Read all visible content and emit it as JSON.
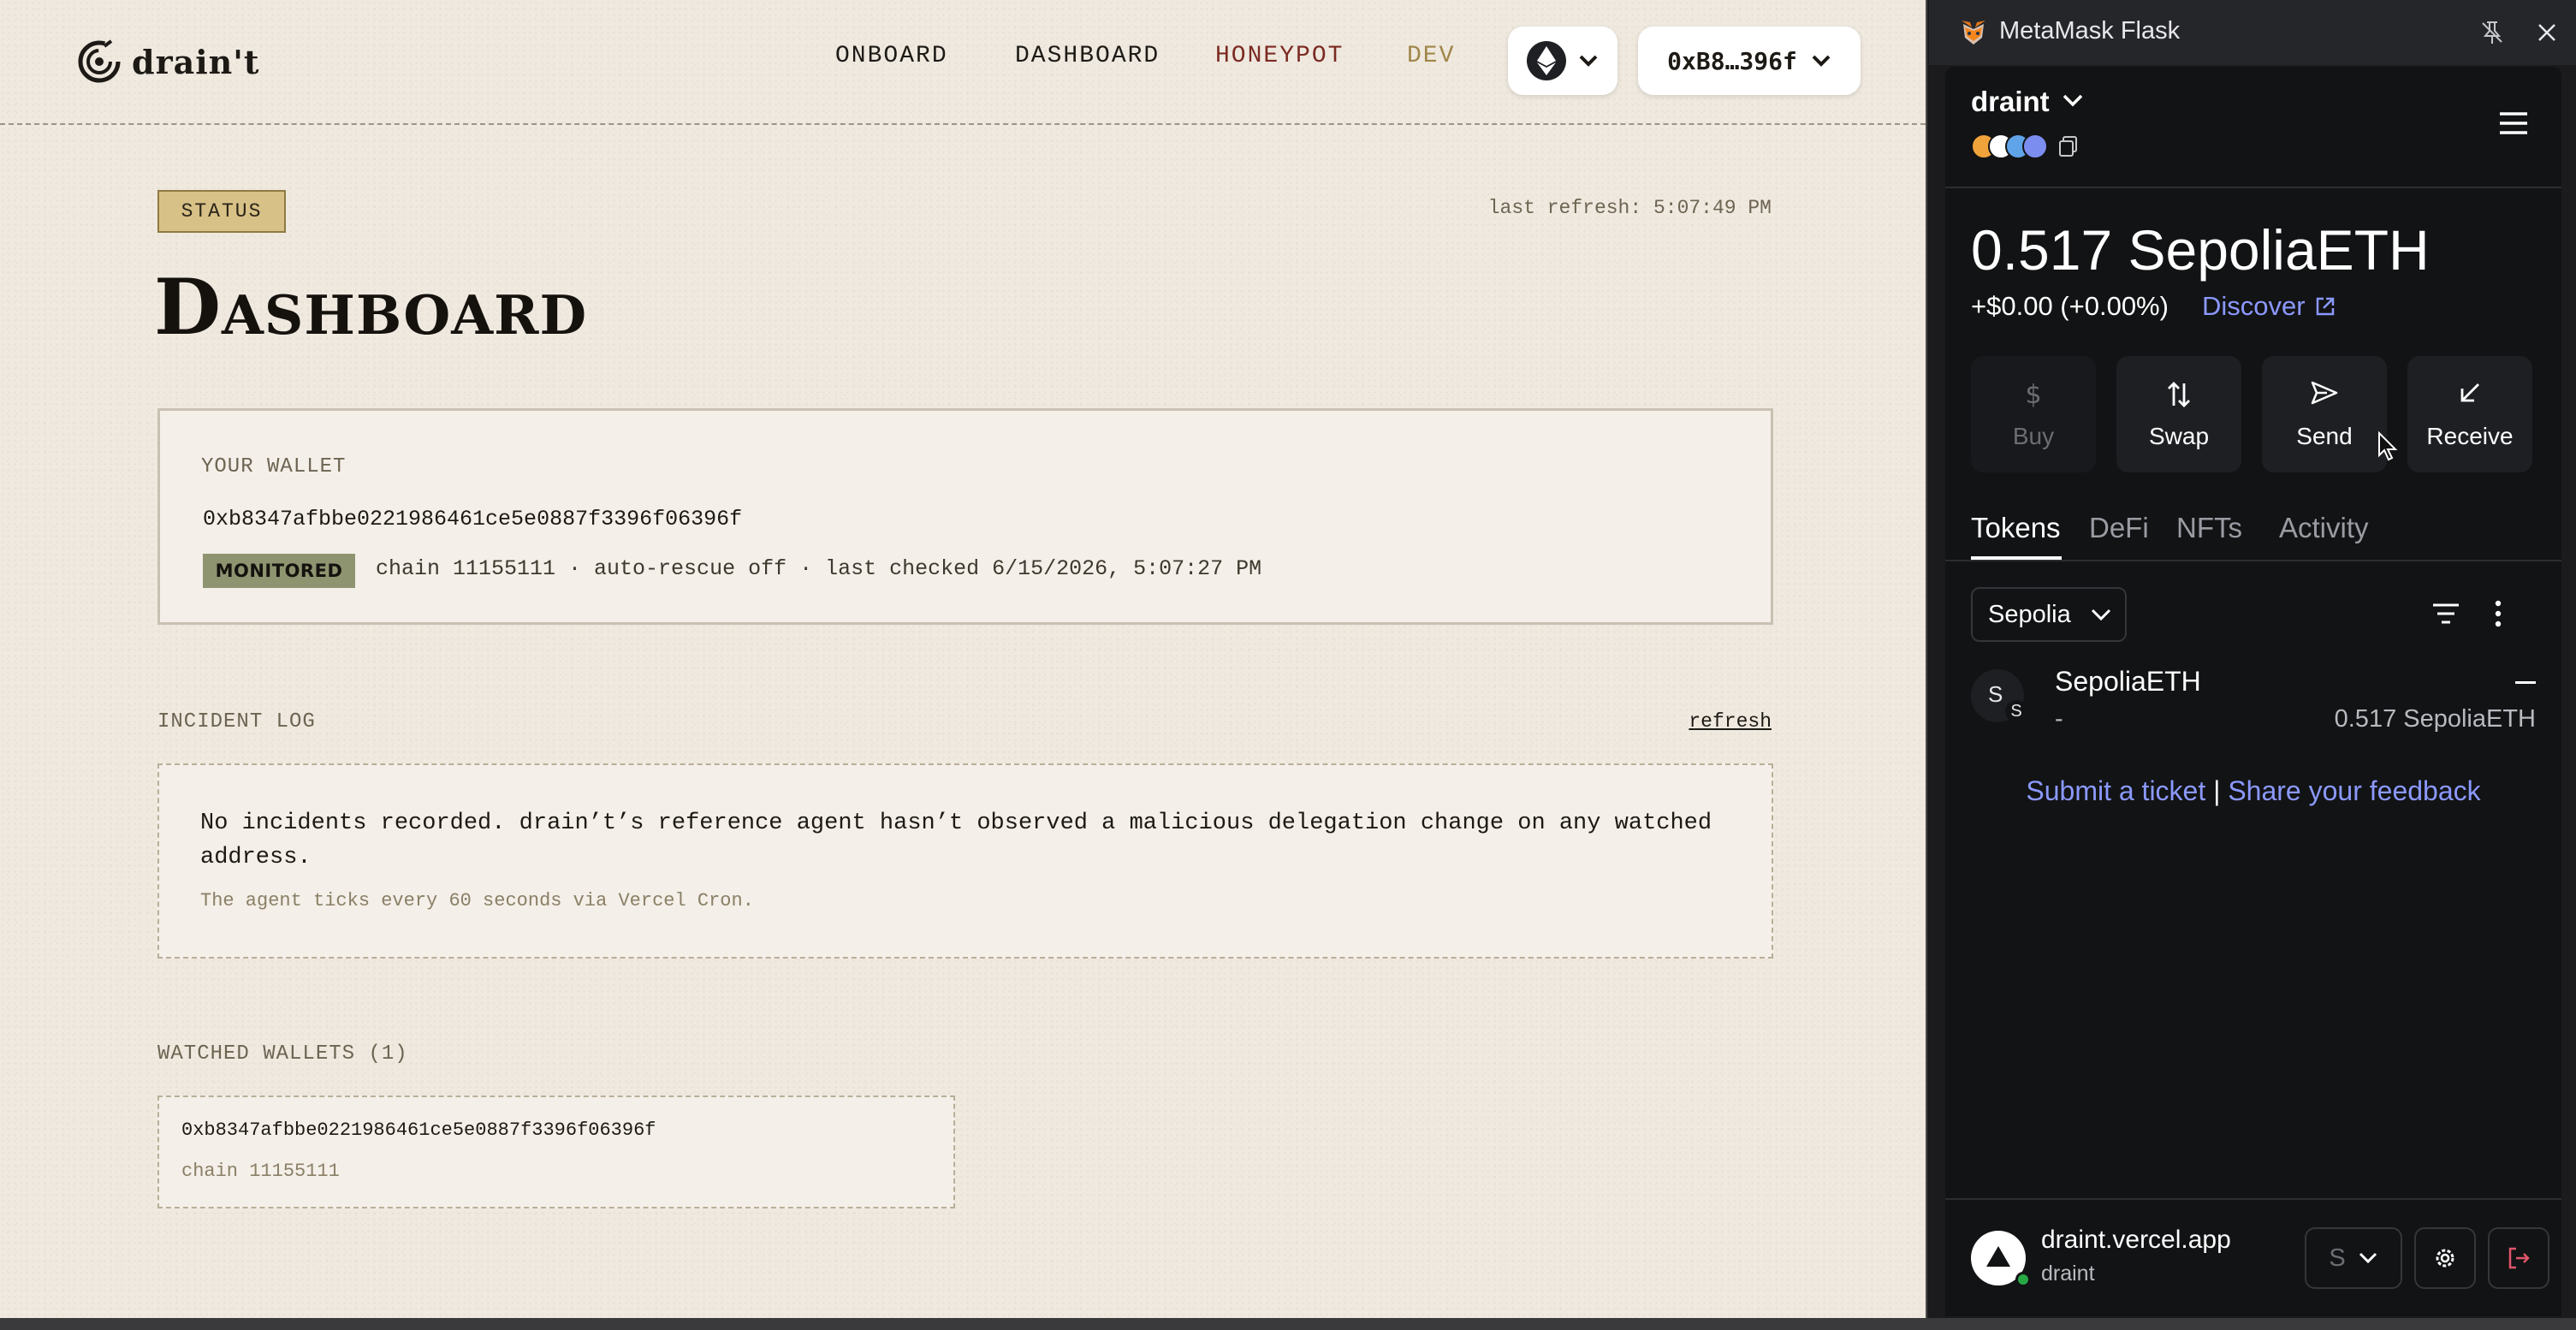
{
  "app": {
    "logo_text": "drain't",
    "nav": {
      "links": [
        {
          "label": "ONBOARD"
        },
        {
          "label": "DASHBOARD"
        },
        {
          "label": "HONEYPOT"
        },
        {
          "label": "DEV"
        }
      ],
      "chain_icon": "ethereum-icon",
      "account_label": "0xB8…396f"
    },
    "status_tag": "STATUS",
    "last_refresh": "last refresh: 5:07:49 PM",
    "title": "Dashboard",
    "wallet_card": {
      "label": "YOUR WALLET",
      "address": "0xb8347afbbe0221986461ce5e0887f3396f06396f",
      "badge": "MONITORED",
      "meta": "chain 11155111 · auto-rescue off · last checked 6/15/2026, 5:07:27 PM"
    },
    "incident_log": {
      "label": "INCIDENT LOG",
      "refresh": "refresh",
      "message": "No incidents recorded. drain’t’s reference agent hasn’t observed a malicious delegation change on any watched address.",
      "sub": "The agent ticks every 60 seconds via Vercel Cron."
    },
    "watched": {
      "label": "WATCHED WALLETS (1)",
      "items": [
        {
          "address": "0xb8347afbbe0221986461ce5e0887f3396f06396f",
          "chain": "chain 11155111"
        }
      ]
    },
    "colors": {
      "background": "#efe9df",
      "accent": "#d8c187",
      "honeypot": "#7b2a22",
      "dev": "#a08548",
      "badge": "#8e9470"
    }
  },
  "metamask": {
    "window_title": "MetaMask Flask",
    "account_name": "draint",
    "balance": "0.517 SepoliaETH",
    "change": "+$0.00 (+0.00%)",
    "discover": "Discover",
    "actions": [
      {
        "label": "Buy",
        "icon": "dollar-icon",
        "disabled": true
      },
      {
        "label": "Swap",
        "icon": "swap-icon",
        "disabled": false
      },
      {
        "label": "Send",
        "icon": "send-icon",
        "disabled": false
      },
      {
        "label": "Receive",
        "icon": "receive-icon",
        "disabled": false
      }
    ],
    "tabs": [
      {
        "label": "Tokens",
        "active": true
      },
      {
        "label": "DeFi",
        "active": false
      },
      {
        "label": "NFTs",
        "active": false
      },
      {
        "label": "Activity",
        "active": false
      }
    ],
    "network_filter": "Sepolia",
    "tokens": [
      {
        "avatar": "S",
        "network_avatar": "S",
        "name": "SepoliaETH",
        "fiat": "—",
        "change": "-",
        "amount": "0.517 SepoliaETH"
      }
    ],
    "feedback": {
      "ticket": "Submit a ticket",
      "separator": "|",
      "share": "Share your feedback"
    },
    "connected_site": {
      "domain": "draint.vercel.app",
      "account": "draint",
      "account_select": "S"
    },
    "colors": {
      "panel": "#121314",
      "link": "#8b99ff",
      "connected": "#28a745"
    }
  }
}
